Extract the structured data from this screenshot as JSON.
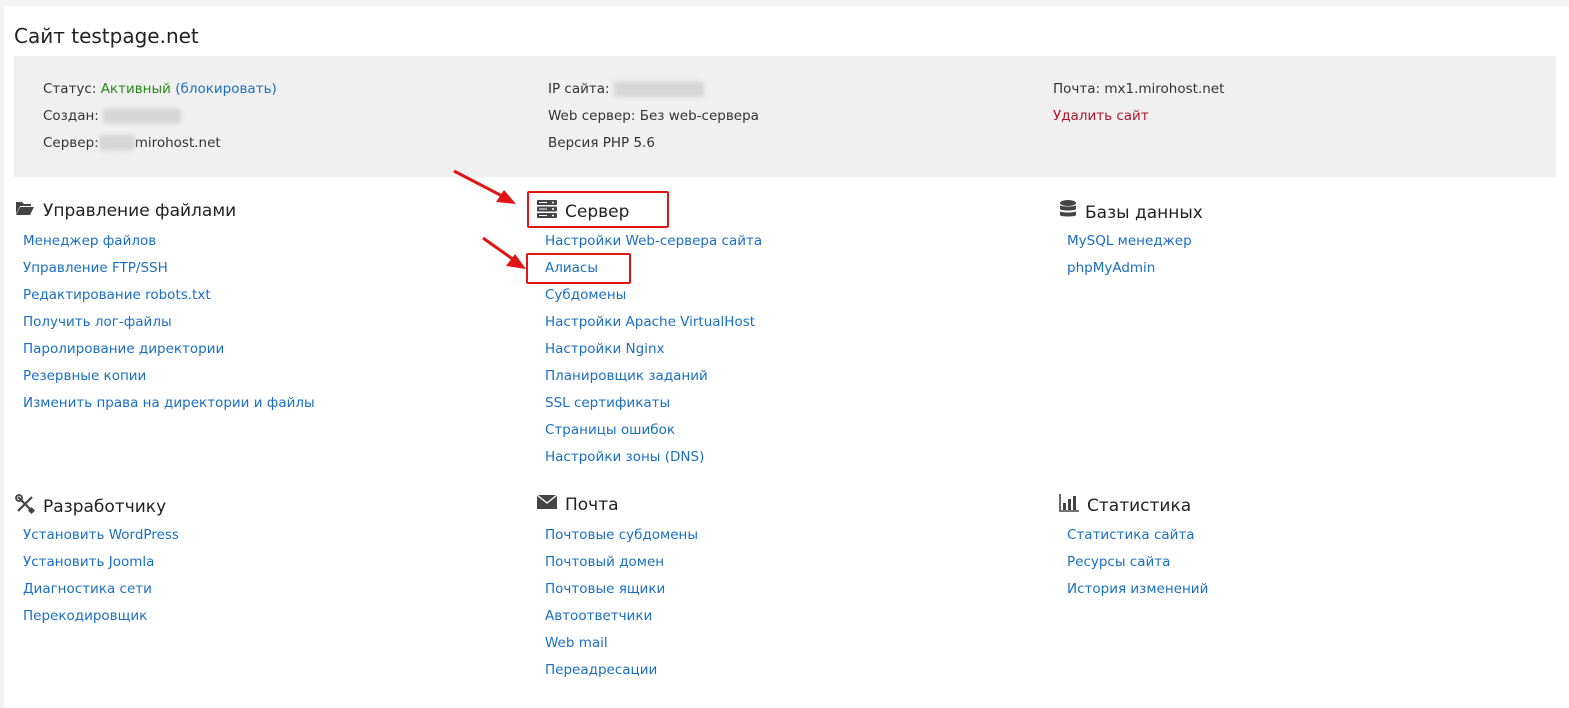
{
  "page_title": "Сайт testpage.net",
  "info": {
    "status_label": "Статус:",
    "status_value": "Активный",
    "status_action": "(блокировать)",
    "created_label": "Создан:",
    "server_label": "Сервер:",
    "server_value": "mirohost.net",
    "ip_label": "IP сайта:",
    "webserver_text": "Web сервер: Без web-сервера",
    "php_text": "Версия PHP 5.6",
    "mail_text": "Почта: mx1.mirohost.net",
    "delete_site": "Удалить сайт"
  },
  "sections": {
    "files": {
      "title": "Управление файлами",
      "icon": "folder-open-icon",
      "items": [
        "Менеджер файлов",
        "Управление FTP/SSH",
        "Редактирование robots.txt",
        "Получить лог-файлы",
        "Паролирование директории",
        "Резервные копии",
        "Изменить права на директории и файлы"
      ]
    },
    "server": {
      "title": "Сервер",
      "icon": "server-icon",
      "items": [
        "Настройки Web-сервера сайта",
        "Алиасы",
        "Субдомены",
        "Настройки Apache VirtualHost",
        "Настройки Nginx",
        "Планировщик заданий",
        "SSL сертификаты",
        "Страницы ошибок",
        "Настройки зоны (DNS)"
      ]
    },
    "databases": {
      "title": "Базы данных",
      "icon": "database-icon",
      "items": [
        "MySQL менеджер",
        "phpMyAdmin"
      ]
    },
    "developer": {
      "title": "Разработчику",
      "icon": "tools-icon",
      "items": [
        "Установить WordPress",
        "Установить Joomla",
        "Диагностика сети",
        "Перекодировщик"
      ]
    },
    "mail": {
      "title": "Почта",
      "icon": "envelope-icon",
      "items": [
        "Почтовые субдомены",
        "Почтовый домен",
        "Почтовые ящики",
        "Автоответчики",
        "Web mail",
        "Переадресации"
      ]
    },
    "stats": {
      "title": "Статистика",
      "icon": "bar-chart-icon",
      "items": [
        "Статистика сайта",
        "Ресурсы сайта",
        "История изменений"
      ]
    }
  },
  "colors": {
    "link": "#1a6fc4",
    "active_status": "#2a8a1c",
    "delete": "#b0152a",
    "annotation": "#e21515"
  }
}
